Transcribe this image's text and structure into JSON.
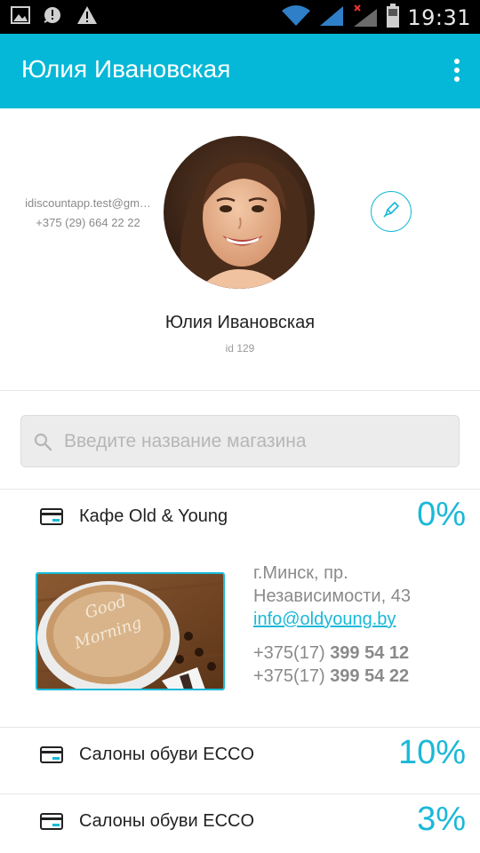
{
  "status_bar": {
    "time": "19:31",
    "icons": [
      "image-icon",
      "sync-alert-icon",
      "warning-icon",
      "wifi-icon",
      "signal-icon",
      "signal-no-data-icon",
      "battery-icon"
    ]
  },
  "app_bar": {
    "title": "Юлия Ивановская",
    "menu_icon": "overflow-menu-icon"
  },
  "profile": {
    "email": "idiscountapp.test@gm…",
    "phone": "+375 (29) 664 22 22",
    "name": "Юлия Ивановская",
    "id": "id 129",
    "edit_icon": "pencil-icon"
  },
  "search": {
    "placeholder": "Введите название магазина",
    "value": ""
  },
  "stores": [
    {
      "name": "Кафе Old & Young",
      "discount": "0%",
      "expanded": true,
      "address_line1": "г.Минск, пр.",
      "address_line2": "Независимости, 43",
      "email": "info@oldyoung.by",
      "phone1_prefix": "+375(17)",
      "phone1_number": "399 54 12",
      "phone2_prefix": "+375(17)",
      "phone2_number": "399 54 22",
      "image_text": "Good Morning"
    },
    {
      "name": "Салоны обуви ECCO",
      "discount": "10%",
      "expanded": false
    },
    {
      "name": "Салоны обуви ECCO",
      "discount": "3%",
      "expanded": false
    }
  ],
  "colors": {
    "accent": "#06b8d7",
    "text": "#222222",
    "muted": "#8a8a8a"
  }
}
